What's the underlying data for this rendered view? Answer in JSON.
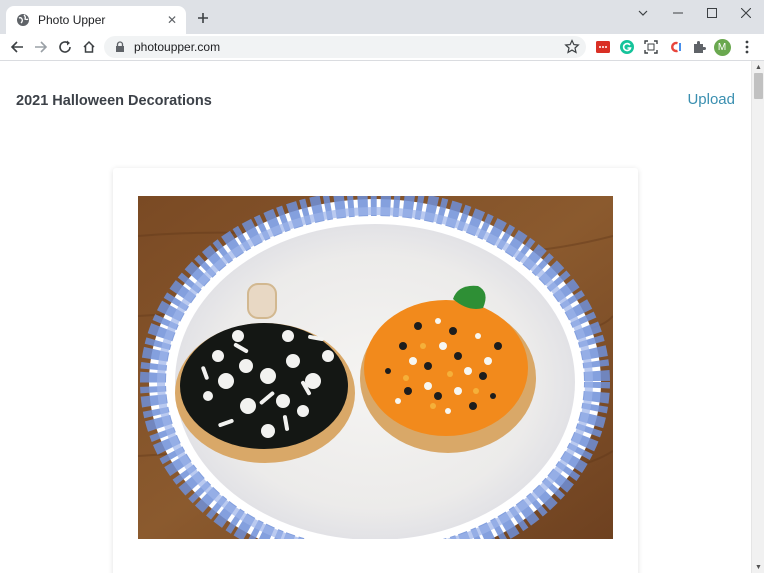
{
  "browser": {
    "tab_title": "Photo Upper",
    "tab_close_icon": "close-icon",
    "new_tab_icon": "plus-icon",
    "url": "photoupper.com",
    "window_controls": [
      "chevron-down-icon",
      "minimize-icon",
      "maximize-icon",
      "close-icon"
    ],
    "nav_icons": [
      "back-arrow-icon",
      "forward-arrow-icon",
      "reload-icon",
      "home-icon"
    ],
    "extensions": [
      "red-extension-icon",
      "grammarly-icon",
      "screenshot-icon",
      "c-extension-icon",
      "puzzle-icon"
    ],
    "profile_initial": "M",
    "menu_icon": "kebab-menu-icon"
  },
  "page": {
    "title": "2021 Halloween Decorations",
    "upload_label": "Upload"
  },
  "colors": {
    "link": "#3a8fb0",
    "title": "#3c4148",
    "profile": "#6aa84f"
  }
}
